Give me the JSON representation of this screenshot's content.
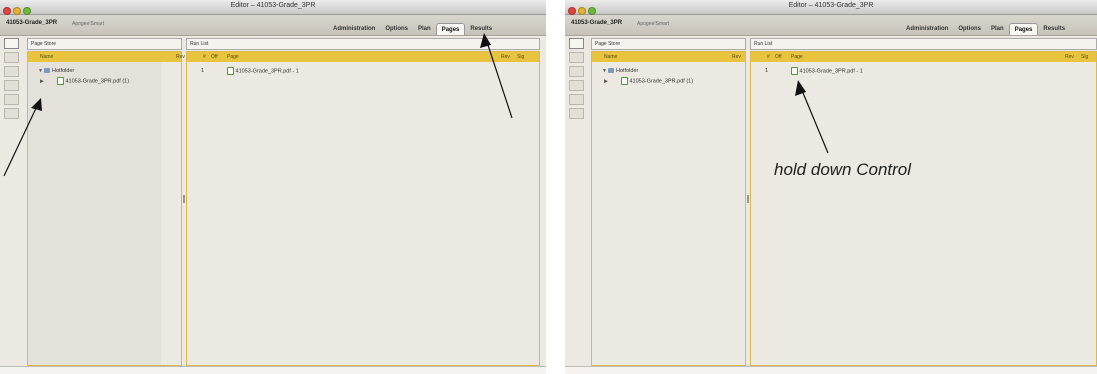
{
  "window": {
    "title": "Editor – 41053-Grade_3PR"
  },
  "toolbar": {
    "job_name": "41053-Grade_3PR",
    "subtitle": "Apogee!Smart"
  },
  "tabs": [
    {
      "label": "Administration"
    },
    {
      "label": "Options"
    },
    {
      "label": "Plan"
    },
    {
      "label": "Pages",
      "active": true
    },
    {
      "label": "Results"
    }
  ],
  "page_store": {
    "title": "Page Store",
    "columns": {
      "name": "Name",
      "rev": "Rev"
    },
    "folder": "Hotfolder",
    "file": "41053-Grade_3PR.pdf (1)"
  },
  "run_list": {
    "title": "Run List",
    "columns": {
      "num": "#",
      "off": "Off",
      "page": "Page",
      "rev": "Rev",
      "sig": "Sig"
    },
    "rows": [
      {
        "num": "1",
        "page": "41053-Grade_3PR.pdf - 1"
      }
    ]
  },
  "annotation": {
    "text": "hold down Control"
  }
}
